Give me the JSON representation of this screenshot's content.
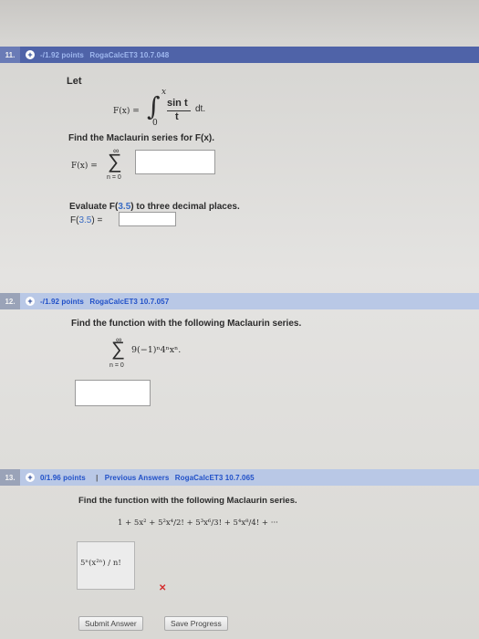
{
  "q11": {
    "number": "11.",
    "points": "-/1.92 points",
    "source": "RogaCalcET3 10.7.048",
    "intro": "Let",
    "F_lhs": "F(x) =",
    "integral_upper": "x",
    "integral_lower": "0",
    "frac_num": "sin t",
    "frac_den": "t",
    "dt": "dt.",
    "task1": "Find the Maclaurin series for F(x).",
    "sum_lhs": "F(x) =",
    "sum_top": "∞",
    "sum_bottom": "n = 0",
    "task2_prefix": "Evaluate F(",
    "task2_value": "3.5",
    "task2_suffix": ") to three decimal places.",
    "eval_prefix": "F(",
    "eval_value": "3.5",
    "eval_suffix": ") ="
  },
  "q12": {
    "number": "12.",
    "points": "-/1.92 points",
    "source": "RogaCalcET3 10.7.057",
    "task": "Find the function with the following Maclaurin series.",
    "sum_top": "∞",
    "sum_bottom": "n = 0",
    "series_term": "9(−1)ⁿ4ⁿxⁿ."
  },
  "q13": {
    "number": "13.",
    "points": "0/1.96 points",
    "sep": "|",
    "prev_answers": "Previous Answers",
    "source": "RogaCalcET3 10.7.065",
    "task": "Find the function with the following Maclaurin series.",
    "series": "1 + 5x² + 5²x⁴/2! + 5³x⁶/3! + 5⁴x⁸/4! + ···",
    "answer_value": "5ⁿ(x²ⁿ) / n!",
    "wrong_mark": "✕"
  },
  "buttons": {
    "submit": "Submit Answer",
    "save": "Save Progress"
  },
  "colors": {
    "q11_bar": "#4f63a8",
    "q12_bar": "#b9c8e6",
    "q13_bar": "#b9c8e6",
    "link_blue": "#2050c8",
    "wrong_red": "#d42c2c"
  }
}
